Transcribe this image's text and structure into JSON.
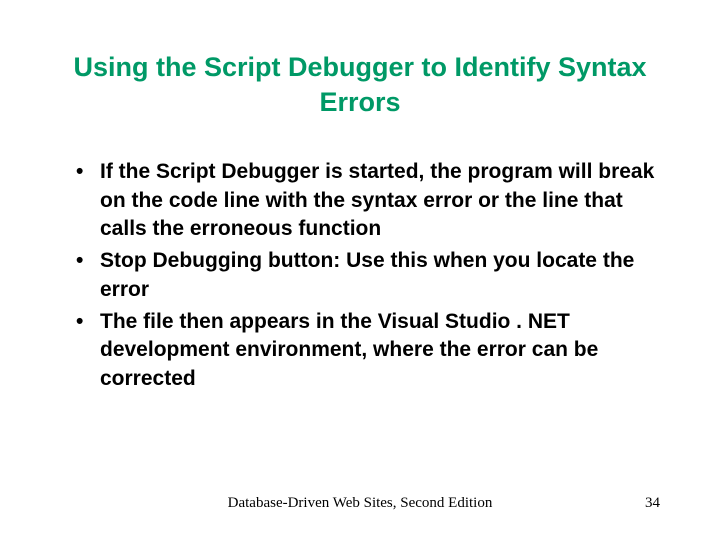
{
  "title": "Using the Script Debugger to Identify Syntax Errors",
  "bullets": [
    "If the Script Debugger is started, the program will break on the code line with the syntax error or the line that calls the erroneous function",
    "Stop Debugging button: Use this when you locate the error",
    "The file then appears in the Visual Studio . NET development environment, where the error can be corrected"
  ],
  "footer": {
    "center": "Database-Driven Web Sites, Second Edition",
    "page": "34"
  }
}
